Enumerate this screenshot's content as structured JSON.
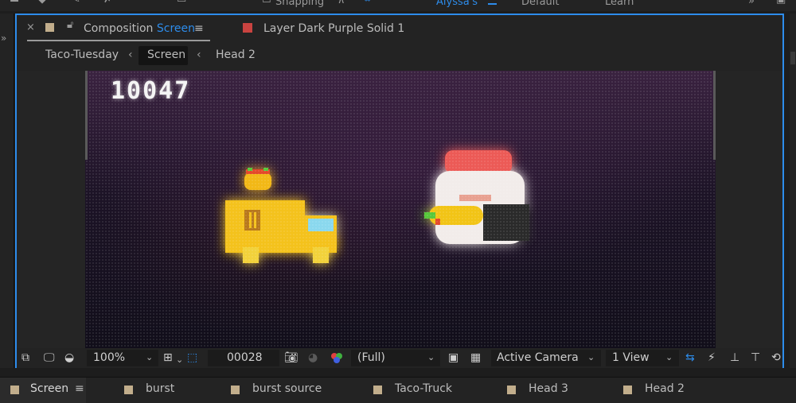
{
  "topbar": {
    "snapping_label": "Snapping",
    "workspace_active": "Alyssa's",
    "workspace_default": "Default",
    "workspace_learn": "Learn",
    "overflow_label": "»"
  },
  "panel": {
    "close_label": "×",
    "comp_prefix": "Composition",
    "comp_name": "Screen",
    "menu_label": "≡",
    "layer_label": "Layer Dark Purple Solid 1",
    "layer_color": "#c94340"
  },
  "breadcrumbs": {
    "items": [
      "Taco-Tuesday",
      "Screen",
      "Head 2"
    ],
    "separator": "‹"
  },
  "viewer": {
    "score": "10047",
    "background_color": "#1c1326"
  },
  "viewer_toolbar": {
    "zoom": "100%",
    "timecode": "00028",
    "resolution": "(Full)",
    "camera": "Active Camera",
    "views": "1 View"
  },
  "timeline_tabs": [
    {
      "label": "Screen",
      "color": "#c2ae8c",
      "active": true
    },
    {
      "label": "burst",
      "color": "#c2ae8c",
      "active": false
    },
    {
      "label": "burst source",
      "color": "#c2ae8c",
      "active": false
    },
    {
      "label": "Taco-Truck",
      "color": "#c2ae8c",
      "active": false
    },
    {
      "label": "Head 3",
      "color": "#c2ae8c",
      "active": false
    },
    {
      "label": "Head 2",
      "color": "#c2ae8c",
      "active": false
    }
  ],
  "timeline_menu_label": "≡",
  "accent_color": "#2d8ceb"
}
